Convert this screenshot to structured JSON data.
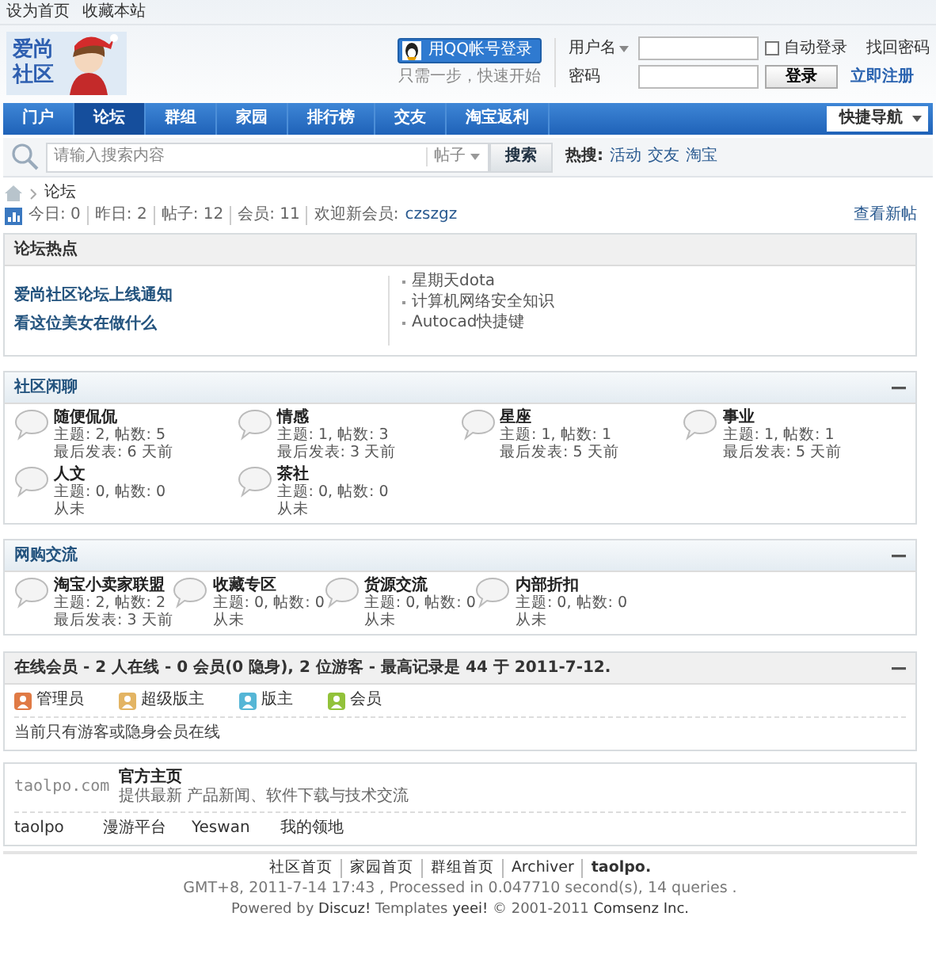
{
  "top_links": [
    "设为首页",
    "收藏本站"
  ],
  "logo": {
    "line1": "爱尚",
    "line2": "社区"
  },
  "qq_login": {
    "label": "用QQ帐号登录",
    "hint": "只需一步，快速开始"
  },
  "login": {
    "username_label": "用户名",
    "password_label": "密码",
    "auto_login": {
      "label": "自动登录",
      "checked": false
    },
    "submit": "登录",
    "links": [
      "找回密码",
      "立即注册"
    ]
  },
  "nav": {
    "items": [
      {
        "label": "门户",
        "selected": false
      },
      {
        "label": "论坛",
        "selected": true
      },
      {
        "label": "群组",
        "selected": false
      },
      {
        "label": "家园",
        "selected": false
      },
      {
        "label": "排行榜",
        "selected": false
      },
      {
        "label": "交友",
        "selected": false
      },
      {
        "label": "淘宝返利",
        "selected": false
      }
    ],
    "quick_nav": "快捷导航"
  },
  "search": {
    "placeholder": "请输入搜索内容",
    "type": "帖子",
    "button": "搜索",
    "hot_label": "热搜:",
    "hot": [
      "活动",
      "交友",
      "淘宝"
    ]
  },
  "breadcrumb": [
    "论坛"
  ],
  "stats": {
    "items": [
      {
        "label": "今日:",
        "value": "0"
      },
      {
        "label": "昨日:",
        "value": "2"
      },
      {
        "label": "帖子:",
        "value": "12"
      },
      {
        "label": "会员:",
        "value": "11"
      }
    ],
    "new_member_label": "欢迎新会员:",
    "new_member": "czszgz",
    "link": "查看新帖"
  },
  "hot": {
    "title": "论坛热点",
    "featured": [
      "爱尚社区论坛上线通知",
      "看这位美女在做什么"
    ],
    "list": [
      "星期天dota",
      "计算机网络安全知识",
      "Autocad快捷键"
    ]
  },
  "categories": [
    {
      "title": "社区闲聊",
      "forums": [
        {
          "name": "随便侃侃",
          "stats": "主题: 2, 帖数: 5",
          "last": "最后发表: 6 天前"
        },
        {
          "name": "情感",
          "stats": "主题: 1, 帖数: 3",
          "last": "最后发表: 3 天前"
        },
        {
          "name": "星座",
          "stats": "主题: 1, 帖数: 1",
          "last": "最后发表: 5 天前"
        },
        {
          "name": "事业",
          "stats": "主题: 1, 帖数: 1",
          "last": "最后发表: 5 天前"
        },
        {
          "name": "人文",
          "stats": "主题: 0, 帖数: 0",
          "last": "从未"
        },
        {
          "name": "茶社",
          "stats": "主题: 0, 帖数: 0",
          "last": "从未"
        }
      ]
    },
    {
      "title": "网购交流",
      "forums": [
        {
          "name": "淘宝小卖家联盟",
          "stats": "主题: 2, 帖数: 2",
          "last": "最后发表: 3 天前"
        },
        {
          "name": "收藏专区",
          "stats": "主题: 0, 帖数: 0",
          "last": "从未"
        },
        {
          "name": "货源交流",
          "stats": "主题: 0, 帖数: 0",
          "last": "从未"
        },
        {
          "name": "内部折扣",
          "stats": "主题: 0, 帖数: 0",
          "last": "从未"
        }
      ]
    }
  ],
  "online": {
    "title": "在线会员",
    "summary": " - 2 人在线 - 0 会员(0 隐身), 2 位游客 - 最高记录是 44 于 2011-7-12.",
    "legend": [
      {
        "label": "管理员",
        "color": "#e07a45"
      },
      {
        "label": "超级版主",
        "color": "#e3b463"
      },
      {
        "label": "版主",
        "color": "#55b6d6"
      },
      {
        "label": "会员",
        "color": "#92c23a"
      }
    ],
    "note": "当前只有游客或隐身会员在线"
  },
  "links": {
    "logo": "taolpo.com",
    "title": "官方主页",
    "desc": "提供最新 产品新闻、软件下载与技术交流",
    "text_links": [
      "taolpo",
      "漫游平台",
      "Yeswan",
      "我的领地"
    ]
  },
  "footer": {
    "links": [
      "社区首页",
      "家园首页",
      "群组首页",
      "Archiver",
      "taolpo."
    ],
    "info": "GMT+8, 2011-7-14 17:43 , Processed in 0.047710 second(s), 14 queries .",
    "powered": "Powered by **Discuz!** Templates **yeei!** © 2001-2011 **Comsenz Inc.**"
  }
}
